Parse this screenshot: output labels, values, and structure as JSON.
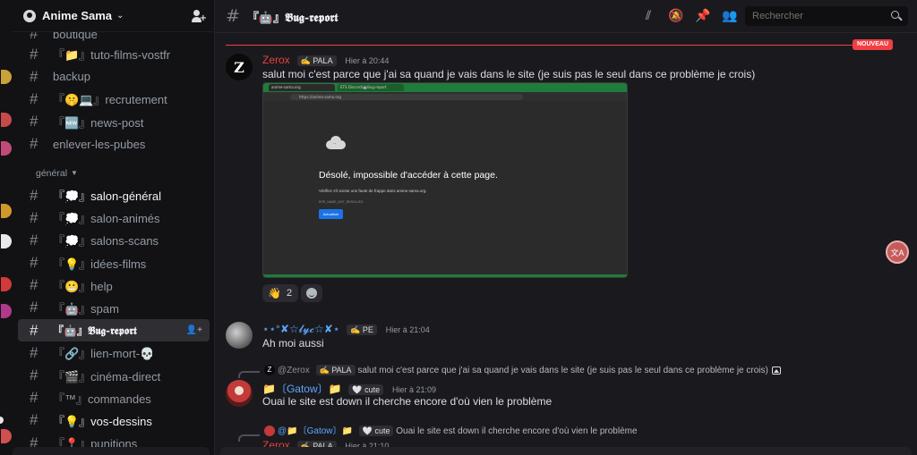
{
  "server": {
    "name": "Anime Sama"
  },
  "sidebar": {
    "channels_top": [
      {
        "name": "boutique"
      },
      {
        "name": "『📁』tuto-films-vostfr"
      },
      {
        "name": "backup"
      },
      {
        "name": "『🤫💻』recrutement"
      },
      {
        "name": "『🆕』news-post"
      },
      {
        "name": "enlever-les-pubes"
      }
    ],
    "category": "général",
    "channels": [
      {
        "name": "『💭』salon-général",
        "unread": true
      },
      {
        "name": "『💭』salon-animés",
        "unread": false
      },
      {
        "name": "『💭』salons-scans",
        "unread": false
      },
      {
        "name": "『💡』idées-films",
        "unread": false
      },
      {
        "name": "『😬』help",
        "unread": false
      },
      {
        "name": "『🤖』spam",
        "unread": false
      },
      {
        "name": "『🤖』𝕭𝖚𝖌-𝖗𝖊𝖕𝖔𝖗𝖙",
        "unread": false,
        "active": true
      },
      {
        "name": "『🔗』lien-mort-💀",
        "unread": false
      },
      {
        "name": "『🎬』cinéma-direct",
        "unread": false
      },
      {
        "name": "『™』commandes",
        "unread": false
      },
      {
        "name": "『💡』vos-dessins",
        "unread": true
      },
      {
        "name": "『📍』punitions",
        "unread": false
      }
    ]
  },
  "topbar": {
    "channel_title": "『🤖』𝕭𝖚𝖌-𝖗𝖊𝖕𝖔𝖗𝖙",
    "search_placeholder": "Rechercher",
    "icons": [
      "threads-icon",
      "mute-icon",
      "pin-icon",
      "members-icon"
    ]
  },
  "chat": {
    "new_badge": "NOUVEAU",
    "messages": [
      {
        "author": "Zerox",
        "author_color": "#e3423f",
        "badge": "✍️ PALA",
        "timestamp": "Hier à 20:44",
        "text": "salut moi c'est parce que j'ai sa quand je vais dans le site (je suis pas le seul dans ce problème je crois)",
        "embed": {
          "tab1": "anime-sama.org",
          "tab2": "ETS Discord/🤖Bug-report",
          "url": "https://anime-sama.org",
          "heading": "Désolé, impossible d'accéder à cette page.",
          "line1": "Vérifiez s'il existe une faute de frappe dans anime-sama.org.",
          "line2": "ERR_NAME_NOT_RESOLVED",
          "button": "Actualiser"
        },
        "reactions": [
          {
            "emoji": "👋",
            "count": "2"
          }
        ]
      },
      {
        "author": "⋆⋆°✘☆𝓵𝔂𝓬☆✘⋆",
        "author_color": "#5ba8ff",
        "badge": "✍️ PE",
        "timestamp": "Hier à 21:04",
        "text": "Ah moi aussi"
      },
      {
        "reply_to_author": "@Zerox",
        "reply_badge": "✍️ PALA",
        "reply_text": "salut moi c'est parce que j'ai sa quand je vais dans le site (je suis pas le seul dans ce problème je crois)",
        "author": "📁〔Gatow〕📁",
        "author_color": "#5ba8ff",
        "badge": "🤍 cute",
        "timestamp": "Hier à 21:09",
        "text": "Ouai le site est down il cherche encore d'où vien le problème"
      },
      {
        "reply_to_author": "@📁〔Gatow〕📁",
        "reply_badge": "🤍 cute",
        "reply_text": "Ouai le site est down il cherche encore d'où vien le problème",
        "author": "Zerox",
        "author_color": "#e3423f",
        "badge": "✍️ PALA",
        "timestamp": "Hier à 21:10"
      }
    ]
  },
  "colors": {
    "accent_red": "#f23f43",
    "link_blue": "#5ba8ff",
    "background": "#1a1a1e"
  }
}
